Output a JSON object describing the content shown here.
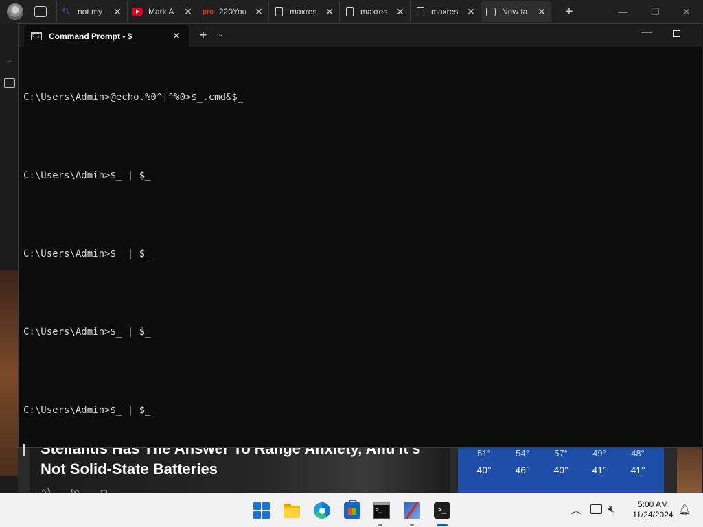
{
  "browser": {
    "tabs": [
      {
        "title": "not my",
        "favicon": "search-icon"
      },
      {
        "title": "Mark A",
        "favicon": "youtube-icon"
      },
      {
        "title": "220You",
        "favicon": "pro-icon",
        "favicon_text": "pro"
      },
      {
        "title": "maxres",
        "favicon": "document-icon"
      },
      {
        "title": "maxres",
        "favicon": "document-icon"
      },
      {
        "title": "maxres",
        "favicon": "document-icon"
      },
      {
        "title": "New ta",
        "favicon": "new-tab-icon",
        "active": true
      }
    ],
    "new_tab_glyph": "+",
    "minimize_glyph": "—",
    "restore_glyph": "❐",
    "close_glyph": "✕"
  },
  "news": {
    "headline": "Stellantis Has The Answer To Range Anxiety, And It's Not Solid-State Batteries"
  },
  "weather": {
    "days": [
      {
        "high": "51°",
        "low": "40°"
      },
      {
        "high": "54°",
        "low": "46°"
      },
      {
        "high": "57°",
        "low": "40°"
      },
      {
        "high": "49°",
        "low": "41°"
      },
      {
        "high": "48°",
        "low": "41°"
      }
    ]
  },
  "terminal": {
    "tab_title": "Command Prompt - $_",
    "new_tab_glyph": "+",
    "dropdown_glyph": "⌄",
    "minimize_glyph": "—",
    "lines": [
      "C:\\Users\\Admin>@echo.%0^|^%0>$_.cmd&$_",
      "C:\\Users\\Admin>$_ | $_",
      "C:\\Users\\Admin>$_ | $_",
      "C:\\Users\\Admin>$_ | $_",
      "C:\\Users\\Admin>$_ | $_"
    ]
  },
  "taskbar": {
    "apps": [
      "start-icon",
      "file-explorer-icon",
      "edge-icon",
      "store-icon",
      "cmd-icon",
      "tool-icon",
      "terminal-icon"
    ],
    "clock_time": "5:00 AM",
    "clock_date": "11/24/2024",
    "colors": {
      "accent": "#0a5fc6",
      "start": "#1a73d9"
    }
  }
}
